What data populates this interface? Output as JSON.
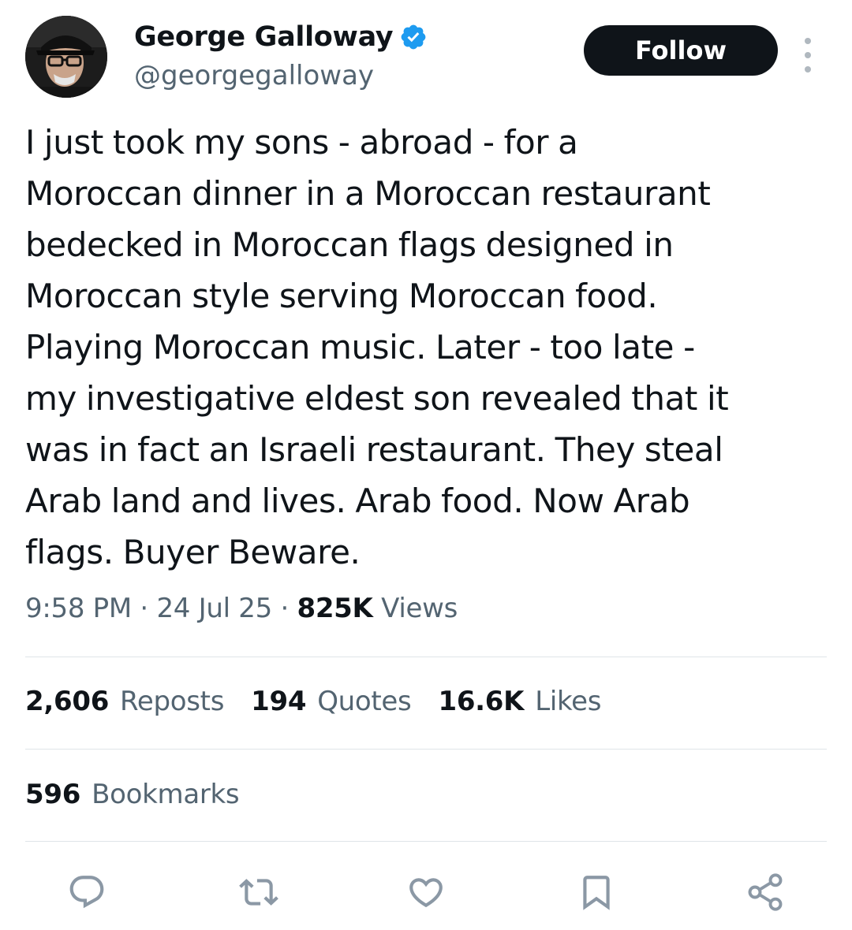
{
  "author": {
    "display_name": "George Galloway",
    "handle": "@georgegalloway",
    "verified": true,
    "verified_color": "#1d9bf0"
  },
  "header": {
    "follow_label": "Follow"
  },
  "tweet": {
    "text": "I just took my sons - abroad - for a\nMoroccan dinner in a Moroccan restaurant\nbedecked in Moroccan flags designed in\nMoroccan style serving Moroccan food.\nPlaying Moroccan music. Later - too late -\nmy investigative eldest son revealed that it\nwas in fact an Israeli restaurant. They steal\nArab land and lives. Arab food. Now Arab\nflags. Buyer Beware."
  },
  "meta": {
    "time": "9:58 PM",
    "separator": "·",
    "date": "24 Jul 25",
    "views_count": "825K",
    "views_label": "Views"
  },
  "stats": {
    "reposts_count": "2,606",
    "reposts_label": "Reposts",
    "quotes_count": "194",
    "quotes_label": "Quotes",
    "likes_count": "16.6K",
    "likes_label": "Likes",
    "bookmarks_count": "596",
    "bookmarks_label": "Bookmarks"
  },
  "actions": [
    "reply-icon",
    "repost-icon",
    "like-icon",
    "bookmark-icon",
    "share-icon"
  ],
  "colors": {
    "text_primary": "#0f1419",
    "text_secondary": "#536471",
    "divider": "#dfe4e8",
    "action_icon": "#8b98a5",
    "follow_bg": "#0f1419"
  }
}
